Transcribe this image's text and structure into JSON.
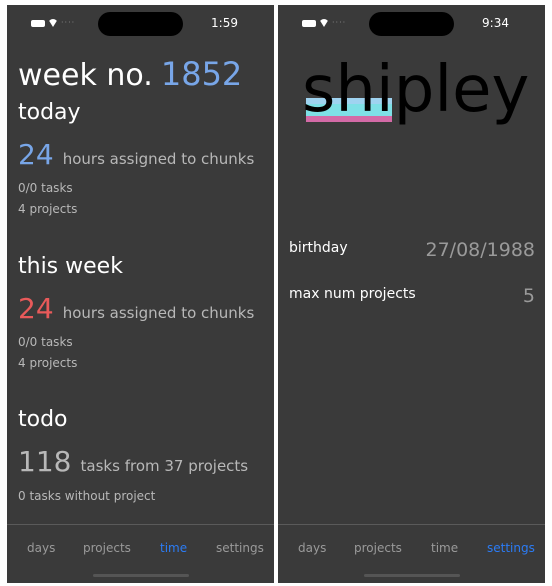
{
  "left": {
    "status": {
      "time": "1:59"
    },
    "week": {
      "label": "week no.",
      "number": "1852"
    },
    "today": {
      "title": "today",
      "hours": "24",
      "hours_text": "hours assigned to chunks",
      "tasks": "0/0 tasks",
      "projects": "4 projects"
    },
    "this_week": {
      "title": "this week",
      "hours": "24",
      "hours_text": "hours assigned to chunks",
      "tasks": "0/0 tasks",
      "projects": "4 projects"
    },
    "todo": {
      "title": "todo",
      "count": "118",
      "count_text": "tasks from 37 projects",
      "without_project": "0 tasks without project"
    },
    "tabs": [
      "days",
      "projects",
      "time",
      "settings"
    ],
    "active_tab": "time"
  },
  "right": {
    "status": {
      "time": "9:34"
    },
    "logo": {
      "text": "shipley"
    },
    "settings": [
      {
        "label": "birthday",
        "value": "27/08/1988"
      },
      {
        "label": "max num projects",
        "value": "5"
      }
    ],
    "tabs": [
      "days",
      "projects",
      "time",
      "settings"
    ],
    "active_tab": "settings"
  },
  "colors": {
    "background": "#3a3a3a",
    "accent_blue": "#78a6e8",
    "accent_red": "#e85a5a",
    "tab_active": "#2b7cf6",
    "logo_stripes": [
      "#7ee0e6",
      "#9fd3f0",
      "#d36aa6"
    ]
  },
  "icons": [
    "battery-icon",
    "wifi-icon",
    "signal-dots-icon"
  ]
}
